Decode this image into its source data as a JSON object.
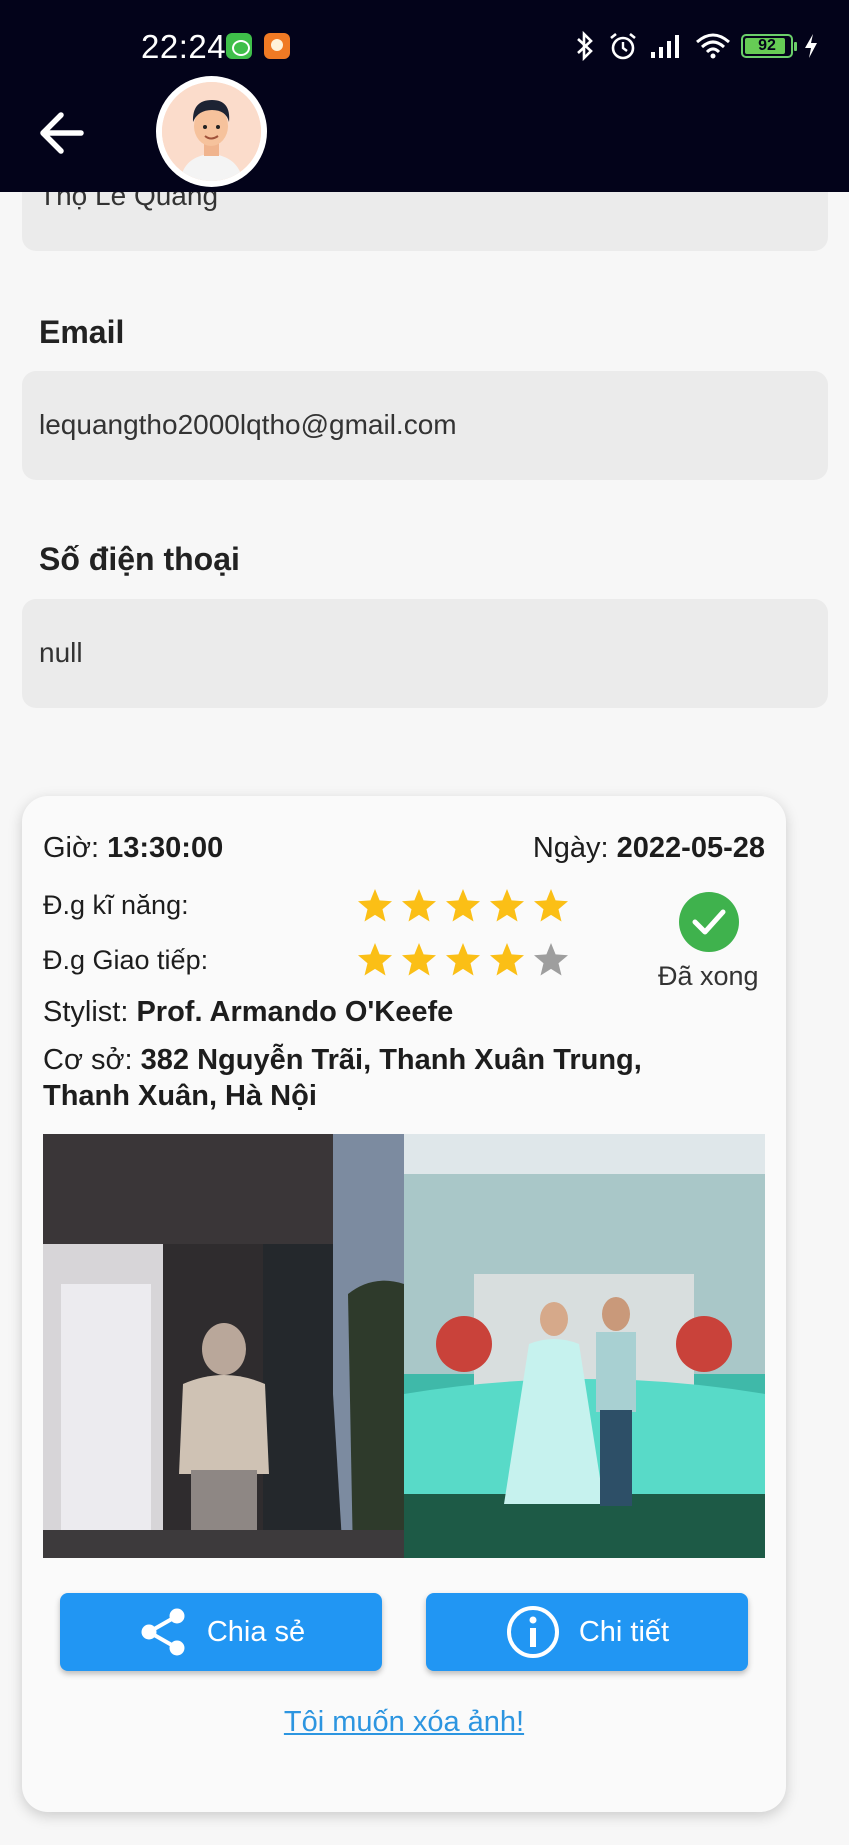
{
  "status_bar": {
    "time": "22:24",
    "battery": "92"
  },
  "profile": {
    "name_value": "Thọ Lê Quang",
    "email_label": "Email",
    "email_value": "lequangtho2000lqtho@gmail.com",
    "phone_label": "Số điện thoại",
    "phone_value": "null"
  },
  "booking": {
    "time_label": "Giờ:",
    "time_value": "13:30:00",
    "date_label": "Ngày:",
    "date_value": "2022-05-28",
    "skill_label": "Đ.g kĩ năng:",
    "skill_rating": 5,
    "comm_label": "Đ.g Giao tiếp:",
    "comm_rating": 4,
    "rating_max": 5,
    "status_text": "Đã xong",
    "stylist_label": "Stylist:",
    "stylist_value": "Prof. Armando O'Keefe",
    "location_label": "Cơ sở:",
    "location_value_line1": "382 Nguyễn Trãi, Thanh Xuân Trung,",
    "location_value_line2": "Thanh Xuân, Hà Nội",
    "share_label": "Chia sẻ",
    "detail_label": "Chi tiết",
    "delete_link": "Tôi muốn xóa ảnh!"
  },
  "colors": {
    "header_bg": "#03031a",
    "star_filled": "#fbbf16",
    "star_empty": "#9e9e9e",
    "done_green": "#3fb24d",
    "button_blue": "#2196f3",
    "link_blue": "#2c95e0"
  },
  "icons": [
    "back-arrow-icon",
    "share-icon",
    "info-icon",
    "check-circle-icon",
    "star-icon"
  ]
}
